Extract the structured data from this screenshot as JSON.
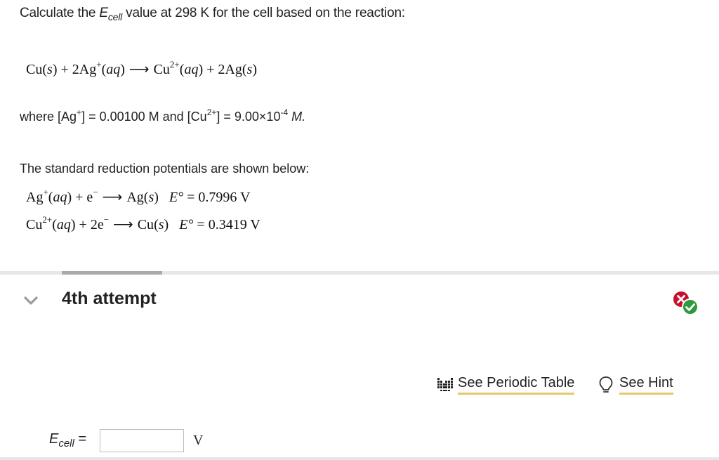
{
  "question": {
    "prefix": "Calculate the ",
    "e_symbol": "E",
    "e_sub": "cell",
    "suffix": " value at 298 K for the cell based on the reaction:"
  },
  "reaction": {
    "r1": "Cu",
    "r1_state": "s",
    "plus1": " + 2Ag",
    "r2_charge": "+",
    "r2_state": "aq",
    "p1": "Cu",
    "p1_charge": "2+",
    "p1_state": "aq",
    "plus2": " + 2Ag",
    "p2_state": "s"
  },
  "conditions": {
    "t1": "where [Ag",
    "c1": "+",
    "t2": "] = 0.00100 M and [Cu",
    "c2": "2+",
    "t3": "] = 9.00×10",
    "exp": "-4",
    "unit": " M."
  },
  "standard_potentials": {
    "title": "The standard reduction potentials are shown below:",
    "ag": {
      "ion": "Ag",
      "ion_charge": "+",
      "state": "aq",
      "electrons": "e",
      "e_charge": "−",
      "product": "Ag",
      "product_state": "s",
      "e0_label": "E°",
      "value": "= 0.7996 V"
    },
    "cu": {
      "ion": "Cu",
      "ion_charge": "2+",
      "state": "aq",
      "electrons": "2e",
      "e_charge": "−",
      "product": "Cu",
      "product_state": "s",
      "e0_label": "E°",
      "value": "= 0.3419 V"
    }
  },
  "attempt": {
    "title": "4th attempt",
    "status_icon": "incorrect-correct-icon"
  },
  "links": {
    "periodic_table": "See Periodic Table",
    "periodic_icon": "periodic-table-icon",
    "hint": "See Hint",
    "hint_icon": "lightbulb-icon",
    "underline_color": "#e3c86a"
  },
  "answer": {
    "label_symbol": "E",
    "label_sub": "cell",
    "label_eq": " =",
    "value": "",
    "unit": "V"
  },
  "colors": {
    "incorrect": "#c8102e",
    "correct": "#2e9a3e"
  }
}
